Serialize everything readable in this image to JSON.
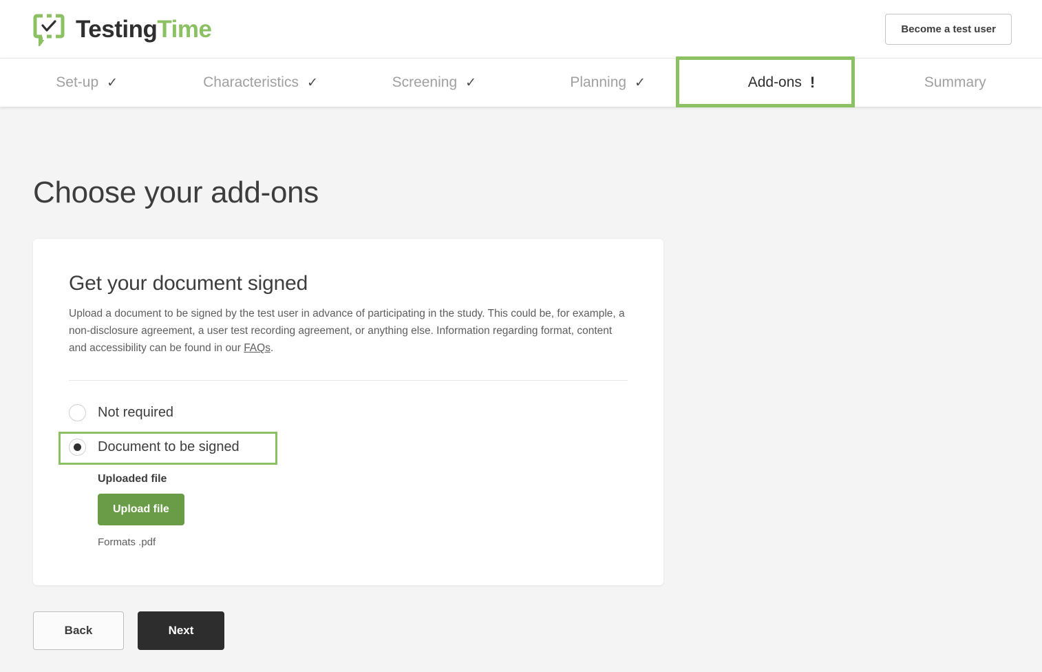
{
  "brand": {
    "name_part1": "Testing",
    "name_part2": "Time",
    "logo_icon": "speech-bubble-check-icon"
  },
  "header": {
    "cta_label": "Become a test user"
  },
  "nav": {
    "items": [
      {
        "label": "Set-up",
        "status": "✓",
        "active": false
      },
      {
        "label": "Characteristics",
        "status": "✓",
        "active": false
      },
      {
        "label": "Screening",
        "status": "✓",
        "active": false
      },
      {
        "label": "Planning",
        "status": "✓",
        "active": false
      },
      {
        "label": "Add-ons",
        "status": "!",
        "active": true
      },
      {
        "label": "Summary",
        "status": "",
        "active": false
      }
    ]
  },
  "main": {
    "page_title": "Choose your add-ons",
    "card": {
      "title": "Get your document signed",
      "description_part1": "Upload a document to be signed by the test user in advance of participating in the study. This could be, for example, a non-disclosure agreement, a user test recording agreement, or anything else. Information regarding format, content and accessibility can be found in our ",
      "description_link": "FAQs",
      "description_part2": ".",
      "options": [
        {
          "label": "Not required",
          "selected": false
        },
        {
          "label": "Document to be signed",
          "selected": true
        }
      ],
      "upload": {
        "label": "Uploaded file",
        "button_label": "Upload file",
        "formats_note": "Formats .pdf"
      }
    }
  },
  "footer": {
    "back_label": "Back",
    "next_label": "Next"
  },
  "colors": {
    "brand_green": "#8bc163",
    "button_green": "#6a9c47",
    "highlight_green": "#8bc163",
    "primary_dark": "#2d2d2d",
    "page_background": "#f4f4f5"
  }
}
